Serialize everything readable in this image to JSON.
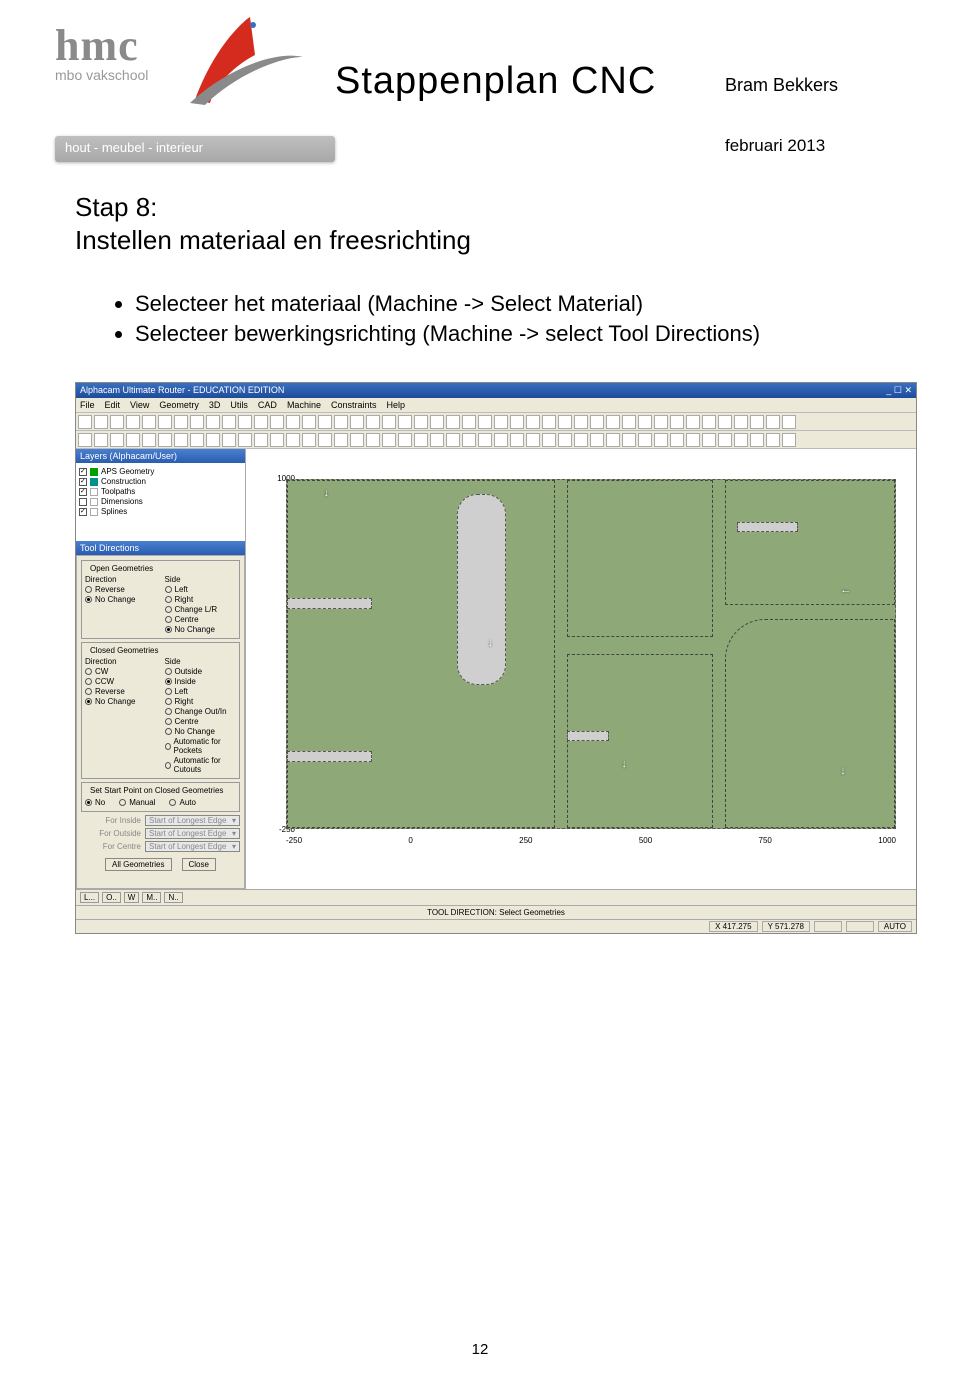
{
  "header": {
    "logo_text": "hmc",
    "logo_sub": "mbo vakschool",
    "tagline": "hout  -  meubel  -  interieur",
    "title": "Stappenplan CNC",
    "author": "Bram Bekkers",
    "date": "februari 2013"
  },
  "content": {
    "step_label": "Stap 8:",
    "step_title": "Instellen materiaal en freesrichting",
    "bullets": [
      "Selecteer het materiaal (Machine -> Select Material)",
      "Selecteer bewerkingsrichting (Machine -> select Tool Directions)"
    ]
  },
  "screenshot": {
    "window_title": "Alphacam Ultimate Router - EDUCATION EDITION",
    "menu": [
      "File",
      "Edit",
      "View",
      "Geometry",
      "3D",
      "Utils",
      "CAD",
      "Machine",
      "Constraints",
      "Help"
    ],
    "layers_panel_title": "Layers (Alphacam/User)",
    "layers": [
      {
        "name": "APS Geometry",
        "color": "#00a000",
        "checked": true
      },
      {
        "name": "Construction",
        "color": "#009090",
        "checked": true
      },
      {
        "name": "Toolpaths",
        "color": "#ffffff",
        "checked": true
      },
      {
        "name": "Dimensions",
        "color": "#ffffff",
        "checked": false
      },
      {
        "name": "Splines",
        "color": "#ffffff",
        "checked": true
      }
    ],
    "tool_dir_title": "Tool Directions",
    "open_geom": {
      "title": "Open Geometries",
      "direction_label": "Direction",
      "directions": [
        "Reverse",
        "No Change"
      ],
      "direction_selected": "No Change",
      "side_label": "Side",
      "sides": [
        "Left",
        "Right",
        "Change L/R",
        "Centre",
        "No Change"
      ],
      "side_selected": "No Change"
    },
    "closed_geom": {
      "title": "Closed Geometries",
      "direction_label": "Direction",
      "directions": [
        "CW",
        "CCW",
        "Reverse",
        "No Change"
      ],
      "direction_selected": "No Change",
      "side_label": "Side",
      "sides": [
        "Outside",
        "Inside",
        "Left",
        "Right",
        "Change Out/In",
        "Centre",
        "No Change",
        "Automatic for Pockets",
        "Automatic for Cutouts"
      ],
      "side_selected": "Inside"
    },
    "start_point": {
      "title": "Set Start Point on Closed Geometries",
      "options": [
        "No",
        "Manual",
        "Auto"
      ],
      "selected": "No"
    },
    "dropdowns": {
      "inside_label": "For Inside",
      "outside_label": "For Outside",
      "centre_label": "For Centre",
      "value": "Start of Longest Edge"
    },
    "buttons": {
      "all": "All Geometries",
      "close": "Close"
    },
    "ruler_x": [
      "-250",
      "0",
      "250",
      "500",
      "750",
      "1000"
    ],
    "ruler_y": [
      "1000",
      "-250"
    ],
    "statusbar": "TOOL DIRECTION: Select Geometries",
    "coords": {
      "x": "X 417.275",
      "y": "Y 571.278",
      "auto": "AUTO"
    },
    "bottom_tabs": [
      "L...",
      "O..",
      "W",
      "M..",
      "N.."
    ]
  },
  "page_number": "12"
}
